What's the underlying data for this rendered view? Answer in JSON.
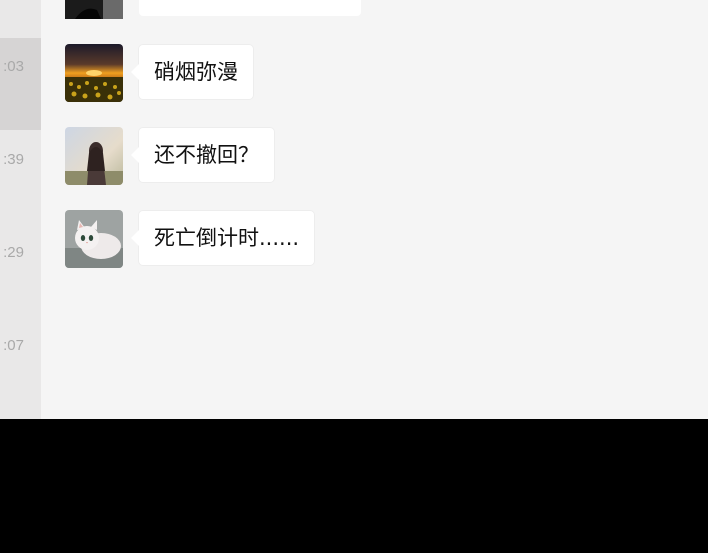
{
  "sidebar": {
    "timestamps": [
      ":03",
      ":39",
      ":29",
      ":07"
    ]
  },
  "chat": {
    "messages": [
      {
        "text": "硝烟弥漫",
        "avatar": "sunset-field-avatar"
      },
      {
        "text": "还不撤回？",
        "avatar": "girl-back-avatar"
      },
      {
        "text": "死亡倒计时......",
        "avatar": "white-cat-avatar"
      }
    ]
  },
  "colors": {
    "chat_bg": "#f5f5f5",
    "sidebar_bg": "#e9e8e8",
    "sidebar_active": "#d6d4d4",
    "bubble": "#ffffff"
  }
}
